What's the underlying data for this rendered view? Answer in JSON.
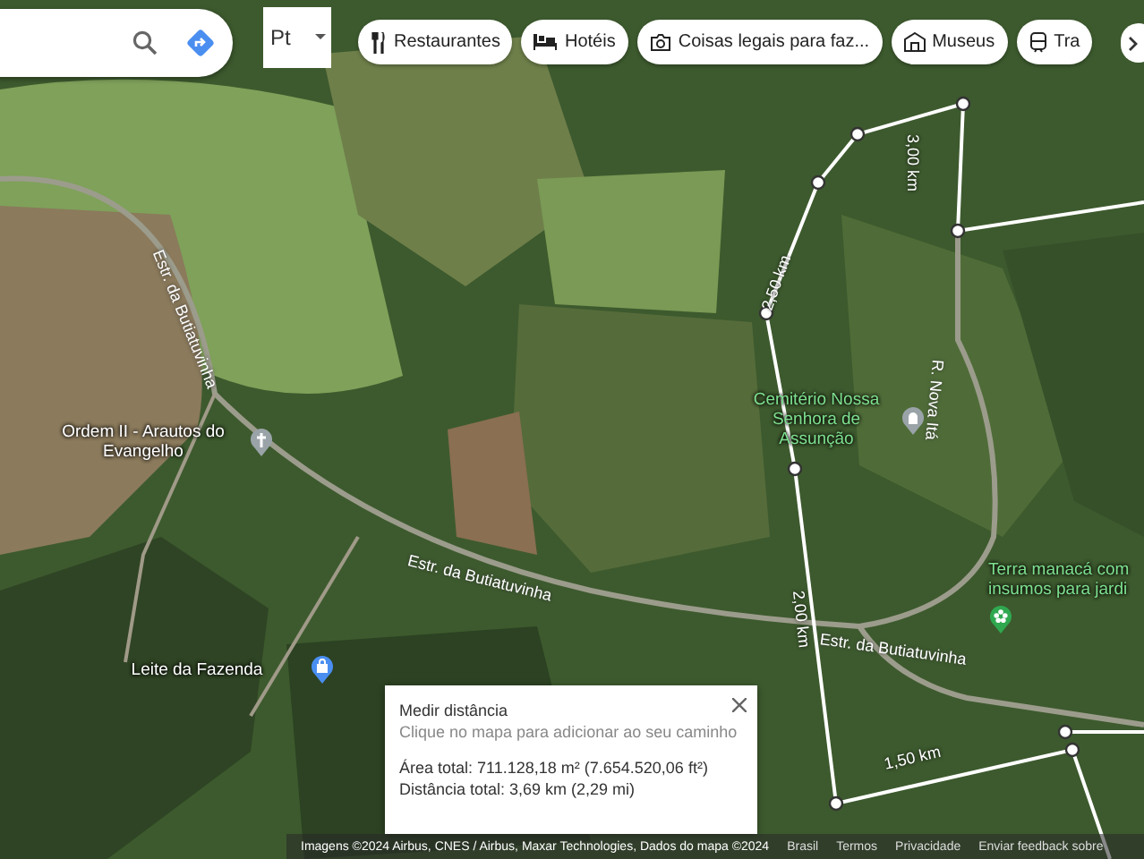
{
  "search": {
    "layer_button": "Pt"
  },
  "chips": [
    {
      "label": "Restaurantes",
      "kind": "restaurant"
    },
    {
      "label": "Hotéis",
      "kind": "hotel"
    },
    {
      "label": "Coisas legais para faz...",
      "kind": "camera"
    },
    {
      "label": "Museus",
      "kind": "museum"
    },
    {
      "label": "Tra",
      "kind": "transit"
    }
  ],
  "places": [
    {
      "name": "Ordem II - Arautos do Evangelho",
      "kind": "church"
    },
    {
      "name": "Leite da Fazenda",
      "kind": "shop"
    },
    {
      "name": "Cemitério Nossa Senhora de Assunção",
      "kind": "cemetery"
    },
    {
      "name": "Terra manacá com insumos para jardi",
      "kind": "garden"
    }
  ],
  "roads": [
    "Estr. da Butiatuvinha",
    "Estr. da Butiatuvinha",
    "Estr. da Butiatuvinha",
    "R. Nova Itá"
  ],
  "distance_marks": [
    "3,00 km",
    "2,50 km",
    "2,00 km",
    "1,50 km"
  ],
  "measure_panel": {
    "title": "Medir distância",
    "hint": "Clique no mapa para adicionar ao seu caminho",
    "area": "Área total: 711.128,18 m² (7.654.520,06 ft²)",
    "distance": "Distância total: 3,69 km (2,29 mi)"
  },
  "footer": {
    "attribution": "Imagens ©2024 Airbus, CNES / Airbus, Maxar Technologies, Dados do mapa ©2024",
    "links": [
      "Brasil",
      "Termos",
      "Privacidade",
      "Enviar feedback sobre"
    ]
  }
}
